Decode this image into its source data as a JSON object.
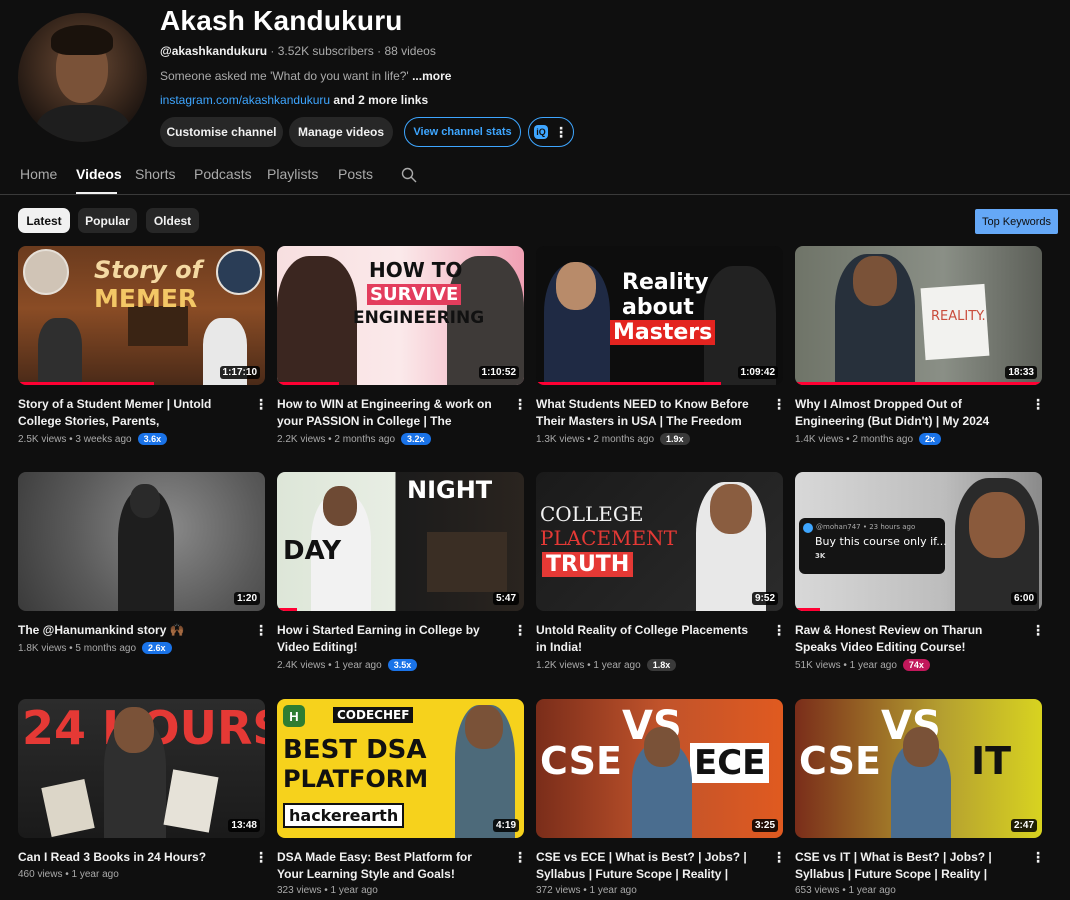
{
  "channel": {
    "name": "Akash Kandukuru",
    "handle": "@akashkandukuru",
    "stats": " · 3.52K subscribers · 88 videos",
    "description": "Someone asked me 'What do you want in life?' ",
    "description_more": "...more",
    "link": "instagram.com/akashkandukuru",
    "more_links": " and 2 more links"
  },
  "actions": {
    "customise": "Customise channel",
    "manage": "Manage videos",
    "stats": "View channel stats",
    "ext_badge": "iQ",
    "ext_dots": "⋮"
  },
  "tabs": [
    "Home",
    "Videos",
    "Shorts",
    "Podcasts",
    "Playlists",
    "Posts"
  ],
  "active_tab": "Videos",
  "filters": {
    "latest": "Latest",
    "popular": "Popular",
    "oldest": "Oldest",
    "active": "Latest"
  },
  "top_keywords": "Top Keywords",
  "colors": {
    "accent": "#3ea6ff",
    "progress": "#ff0033",
    "badge_blue": "#1a73e8",
    "badge_gray": "#3a3a3a",
    "badge_pink": "#c2185b",
    "top_keywords_bg": "#65a8f7"
  },
  "videos": [
    {
      "title": "Story of a Student Memer | Untold College Stories, Parents, Relationships, Backlogs,...",
      "duration": "1:17:10",
      "views": "2.5K views",
      "age": "3 weeks ago",
      "badge": "3.6x",
      "badge_color": "#1a73e8",
      "progress": 0.55,
      "thumb_text_1": "Story of",
      "thumb_text_2": "MEMER"
    },
    {
      "title": "How to WIN at Engineering & work on your PASSION in College | The Freedom Stories...",
      "duration": "1:10:52",
      "views": "2.2K views",
      "age": "2 months ago",
      "badge": "3.2x",
      "badge_color": "#1a73e8",
      "progress": 0.25,
      "thumb_text_1": "HOW TO",
      "thumb_text_2": "SURVIVE",
      "thumb_text_3": "ENGINEERING"
    },
    {
      "title": "What Students NEED to Know Before Their Masters in USA | The Freedom Stories...",
      "duration": "1:09:42",
      "views": "1.3K views",
      "age": "2 months ago",
      "badge": "1.9x",
      "badge_color": "#3a3a3a",
      "progress": 0.75,
      "thumb_text_1": "Reality",
      "thumb_text_2": "about",
      "thumb_text_3": "Masters"
    },
    {
      "title": "Why I Almost Dropped Out of Engineering (But Didn't) | My 2024 Story",
      "duration": "18:33",
      "views": "1.4K views",
      "age": "2 months ago",
      "badge": "2x",
      "badge_color": "#1a73e8",
      "progress": 1.0,
      "thumb_text_1": "REALITY."
    },
    {
      "title": "The @Hanumankind story 🙌🏾",
      "duration": "1:20",
      "views": "1.8K views",
      "age": "5 months ago",
      "badge": "2.6x",
      "badge_color": "#1a73e8",
      "progress": 0,
      "thumb_text_1": ""
    },
    {
      "title": "How i Started Earning in College by Video Editing!",
      "duration": "5:47",
      "views": "2.4K views",
      "age": "1 year ago",
      "badge": "3.5x",
      "badge_color": "#1a73e8",
      "progress": 0.08,
      "thumb_text_1": "DAY",
      "thumb_text_2": "NIGHT"
    },
    {
      "title": "Untold Reality of College Placements in India!",
      "duration": "9:52",
      "views": "1.2K views",
      "age": "1 year ago",
      "badge": "1.8x",
      "badge_color": "#3a3a3a",
      "progress": 0,
      "thumb_text_1": "COLLEGE",
      "thumb_text_2": "PLACEMENT",
      "thumb_text_3": "TRUTH"
    },
    {
      "title": "Raw & Honest Review on Tharun Speaks Video Editing Course!",
      "duration": "6:00",
      "views": "51K views",
      "age": "1 year ago",
      "badge": "74x",
      "badge_color": "#c2185b",
      "progress": 0.1,
      "thumb_text_1": "@mohan747 • 23 hours ago",
      "thumb_text_2": "Buy this course only if...",
      "thumb_text_3": "3K"
    },
    {
      "title": "Can I Read 3 Books in 24 Hours?",
      "duration": "13:48",
      "views": "460 views",
      "age": "1 year ago",
      "badge": "",
      "badge_color": "",
      "progress": 0,
      "thumb_text_1": "24 HOURS"
    },
    {
      "title": "DSA Made Easy: Best Platform for Your Learning Style and Goals!",
      "duration": "4:19",
      "views": "323 views",
      "age": "1 year ago",
      "badge": "",
      "badge_color": "",
      "progress": 0,
      "thumb_text_1": "CODECHEF",
      "thumb_text_2": "BEST DSA",
      "thumb_text_3": "PLATFORM",
      "thumb_text_4": "hackerearth"
    },
    {
      "title": "CSE vs ECE | What is Best? | Jobs? | Syllabus | Future Scope | Reality | Avoid Big Mistake...",
      "duration": "3:25",
      "views": "372 views",
      "age": "1 year ago",
      "badge": "",
      "badge_color": "",
      "progress": 0,
      "thumb_text_1": "CSE",
      "thumb_text_2": "VS",
      "thumb_text_3": "ECE"
    },
    {
      "title": "CSE vs IT | What is Best? | Jobs? | Syllabus | Future Scope | Reality | Avoid Big Mistake...",
      "duration": "2:47",
      "views": "653 views",
      "age": "1 year ago",
      "badge": "",
      "badge_color": "",
      "progress": 0,
      "thumb_text_1": "CSE",
      "thumb_text_2": "VS",
      "thumb_text_3": "IT"
    }
  ]
}
